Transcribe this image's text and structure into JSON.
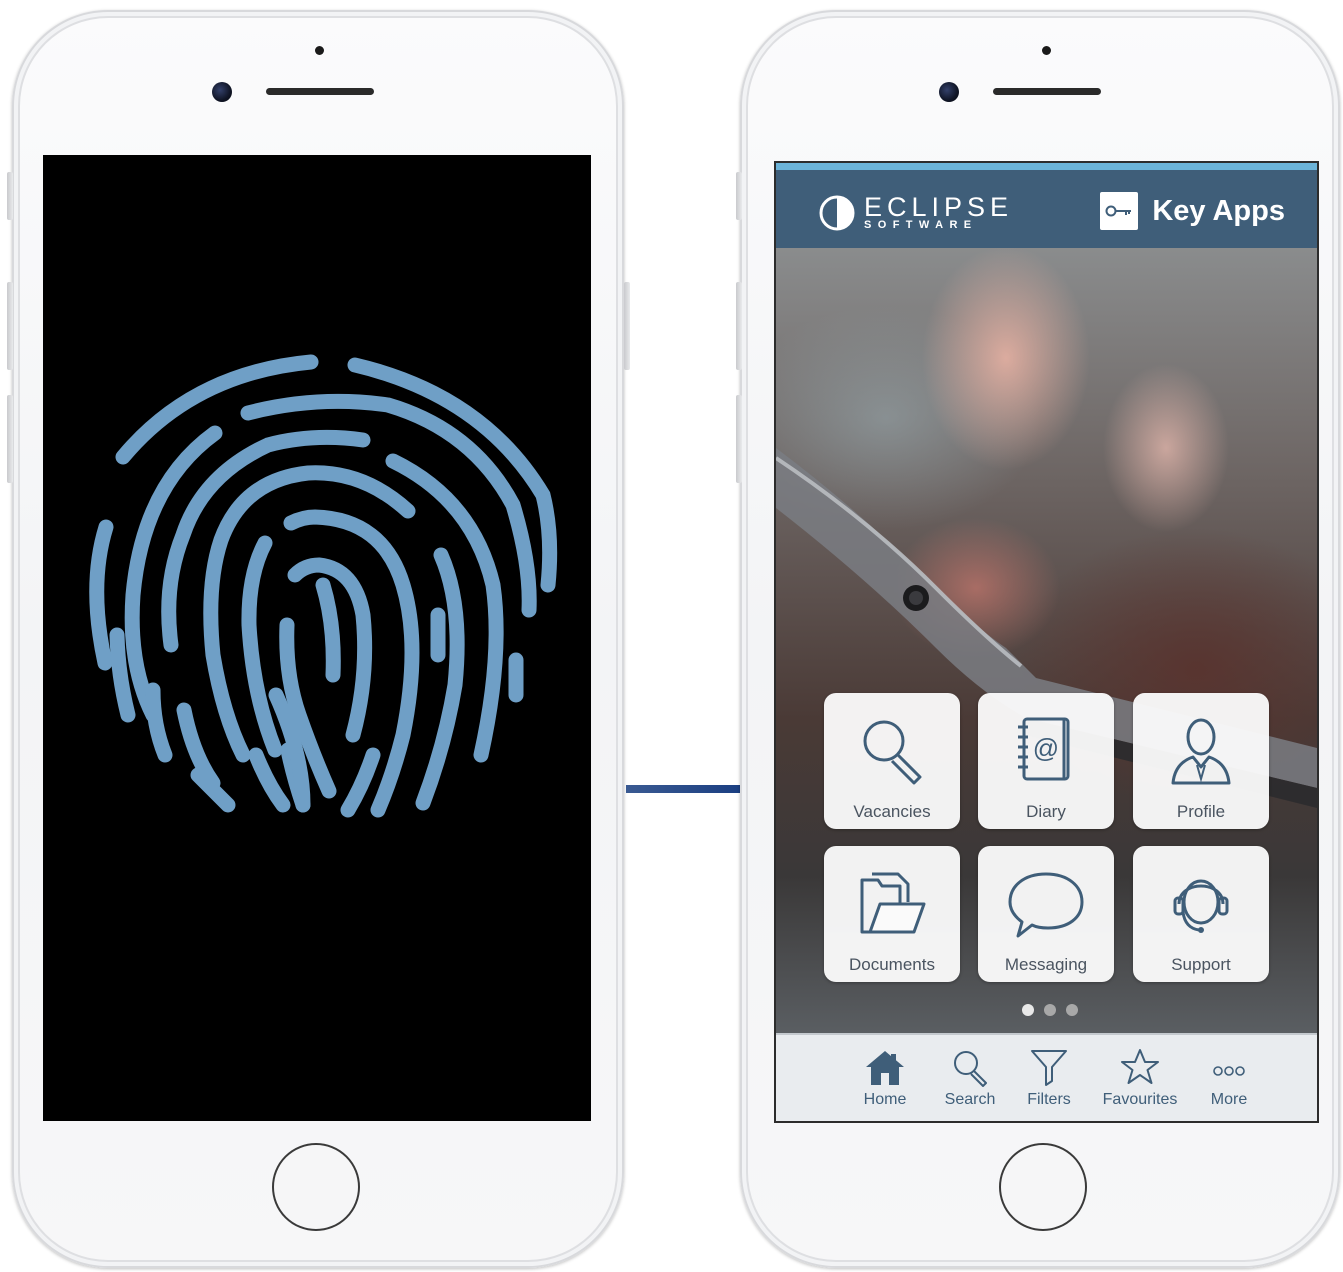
{
  "brand": {
    "logo_main": "ECLIPSE",
    "logo_sub": "SOFTWARE",
    "app_name": "Key Apps",
    "header_color": "#3f5e79",
    "accent_color": "#6bb3d8",
    "fingerprint_color": "#6f9fc6"
  },
  "tiles": [
    {
      "label": "Vacancies",
      "icon": "magnifier-icon"
    },
    {
      "label": "Diary",
      "icon": "address-book-icon"
    },
    {
      "label": "Profile",
      "icon": "user-icon"
    },
    {
      "label": "Documents",
      "icon": "folder-icon"
    },
    {
      "label": "Messaging",
      "icon": "speech-bubble-icon"
    },
    {
      "label": "Support",
      "icon": "headset-icon"
    }
  ],
  "pager": {
    "total": 3,
    "active": 1
  },
  "tabbar": [
    {
      "label": "Home",
      "icon": "home-icon"
    },
    {
      "label": "Search",
      "icon": "search-icon"
    },
    {
      "label": "Filters",
      "icon": "filter-icon"
    },
    {
      "label": "Favourites",
      "icon": "star-icon"
    },
    {
      "label": "More",
      "icon": "more-icon"
    }
  ]
}
